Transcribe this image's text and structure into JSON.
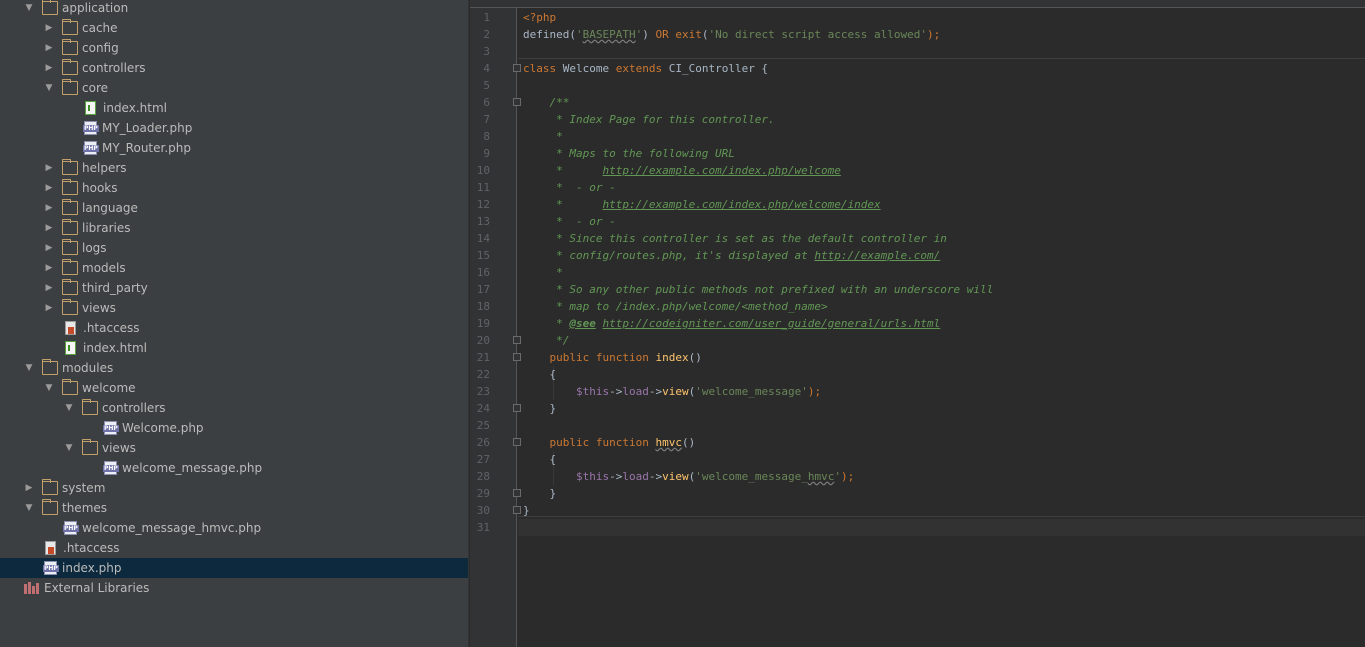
{
  "sidebar": {
    "rows": [
      {
        "id": "application",
        "depth": 0,
        "arrow": "open",
        "icon": "folder",
        "label": "application"
      },
      {
        "id": "cache",
        "depth": 1,
        "arrow": "closed",
        "icon": "folder",
        "label": "cache"
      },
      {
        "id": "config",
        "depth": 1,
        "arrow": "closed",
        "icon": "folder",
        "label": "config"
      },
      {
        "id": "controllers",
        "depth": 1,
        "arrow": "closed",
        "icon": "folder",
        "label": "controllers"
      },
      {
        "id": "core",
        "depth": 1,
        "arrow": "open",
        "icon": "folder",
        "label": "core"
      },
      {
        "id": "core-index-html",
        "depth": 2,
        "arrow": "none",
        "icon": "html",
        "label": "index.html"
      },
      {
        "id": "my-loader",
        "depth": 2,
        "arrow": "none",
        "icon": "php",
        "label": "MY_Loader.php"
      },
      {
        "id": "my-router",
        "depth": 2,
        "arrow": "none",
        "icon": "php",
        "label": "MY_Router.php"
      },
      {
        "id": "helpers",
        "depth": 1,
        "arrow": "closed",
        "icon": "folder",
        "label": "helpers"
      },
      {
        "id": "hooks",
        "depth": 1,
        "arrow": "closed",
        "icon": "folder",
        "label": "hooks"
      },
      {
        "id": "language",
        "depth": 1,
        "arrow": "closed",
        "icon": "folder",
        "label": "language"
      },
      {
        "id": "libraries",
        "depth": 1,
        "arrow": "closed",
        "icon": "folder",
        "label": "libraries"
      },
      {
        "id": "logs",
        "depth": 1,
        "arrow": "closed",
        "icon": "folder",
        "label": "logs"
      },
      {
        "id": "models",
        "depth": 1,
        "arrow": "closed",
        "icon": "folder",
        "label": "models"
      },
      {
        "id": "third-party",
        "depth": 1,
        "arrow": "closed",
        "icon": "folder",
        "label": "third_party"
      },
      {
        "id": "views",
        "depth": 1,
        "arrow": "closed",
        "icon": "folder",
        "label": "views"
      },
      {
        "id": "app-htaccess",
        "depth": 1,
        "arrow": "none",
        "icon": "htaccess",
        "label": ".htaccess"
      },
      {
        "id": "app-index-html",
        "depth": 1,
        "arrow": "none",
        "icon": "html",
        "label": "index.html"
      },
      {
        "id": "modules",
        "depth": 0,
        "arrow": "open",
        "icon": "folder",
        "label": "modules"
      },
      {
        "id": "welcome",
        "depth": 1,
        "arrow": "open",
        "icon": "folder",
        "label": "welcome"
      },
      {
        "id": "welcome-controllers",
        "depth": 2,
        "arrow": "open",
        "icon": "folder",
        "label": "controllers"
      },
      {
        "id": "welcome-php",
        "depth": 3,
        "arrow": "none",
        "icon": "php",
        "label": "Welcome.php"
      },
      {
        "id": "welcome-views",
        "depth": 2,
        "arrow": "open",
        "icon": "folder",
        "label": "views"
      },
      {
        "id": "welcome-message-php",
        "depth": 3,
        "arrow": "none",
        "icon": "php",
        "label": "welcome_message.php"
      },
      {
        "id": "system",
        "depth": 0,
        "arrow": "closed",
        "icon": "folder",
        "label": "system"
      },
      {
        "id": "themes",
        "depth": 0,
        "arrow": "open",
        "icon": "folder",
        "label": "themes"
      },
      {
        "id": "welcome-message-hmvc",
        "depth": 1,
        "arrow": "none",
        "icon": "php",
        "label": "welcome_message_hmvc.php"
      },
      {
        "id": "root-htaccess",
        "depth": 0,
        "arrow": "none",
        "icon": "htaccess",
        "label": ".htaccess"
      },
      {
        "id": "root-index-php",
        "depth": 0,
        "arrow": "none",
        "icon": "php",
        "label": "index.php",
        "selected": true
      },
      {
        "id": "external-libraries",
        "depth": -1,
        "arrow": "none",
        "icon": "library",
        "label": "External Libraries"
      }
    ]
  },
  "editor": {
    "line_numbers": [
      "1",
      "2",
      "3",
      "4",
      "5",
      "6",
      "7",
      "8",
      "9",
      "10",
      "11",
      "12",
      "13",
      "14",
      "15",
      "16",
      "17",
      "18",
      "19",
      "20",
      "21",
      "22",
      "23",
      "24",
      "25",
      "26",
      "27",
      "28",
      "29",
      "30",
      "31"
    ],
    "lines": [
      [
        {
          "t": "<?php",
          "c": "ptag"
        }
      ],
      [
        {
          "t": "defined(",
          "c": ""
        },
        {
          "t": "'",
          "c": "str"
        },
        {
          "t": "BASEPATH",
          "c": "str wavy"
        },
        {
          "t": "'",
          "c": "str"
        },
        {
          "t": ") ",
          "c": ""
        },
        {
          "t": "OR ",
          "c": "kw"
        },
        {
          "t": "exit",
          "c": "kw"
        },
        {
          "t": "(",
          "c": ""
        },
        {
          "t": "'No direct script access allowed'",
          "c": "str"
        },
        {
          "t": ");",
          "c": "kw"
        }
      ],
      [],
      [
        {
          "t": "class ",
          "c": "kw"
        },
        {
          "t": "Welcome ",
          "c": ""
        },
        {
          "t": "extends ",
          "c": "kw"
        },
        {
          "t": "CI_Controller {",
          "c": ""
        }
      ],
      [],
      [
        {
          "t": "    /**",
          "c": "cm"
        }
      ],
      [
        {
          "t": "     * Index Page for this controller.",
          "c": "cm"
        }
      ],
      [
        {
          "t": "     *",
          "c": "cm"
        }
      ],
      [
        {
          "t": "     * Maps to the following URL",
          "c": "cm"
        }
      ],
      [
        {
          "t": "     *      ",
          "c": "cm"
        },
        {
          "t": "http://example.com/index.php/welcome",
          "c": "url"
        }
      ],
      [
        {
          "t": "     *  - or -",
          "c": "cm"
        }
      ],
      [
        {
          "t": "     *      ",
          "c": "cm"
        },
        {
          "t": "http://example.com/index.php/welcome/index",
          "c": "url"
        }
      ],
      [
        {
          "t": "     *  - or -",
          "c": "cm"
        }
      ],
      [
        {
          "t": "     * Since this controller is set as the default controller in",
          "c": "cm"
        }
      ],
      [
        {
          "t": "     * config/routes.php, it's displayed at ",
          "c": "cm"
        },
        {
          "t": "http://example.com/",
          "c": "url"
        }
      ],
      [
        {
          "t": "     *",
          "c": "cm"
        }
      ],
      [
        {
          "t": "     * So any other public methods not prefixed with an underscore will",
          "c": "cm"
        }
      ],
      [
        {
          "t": "     * map to /index.php/welcome/<method_name>",
          "c": "cm"
        }
      ],
      [
        {
          "t": "     * ",
          "c": "cm"
        },
        {
          "t": "@see",
          "c": "tag"
        },
        {
          "t": " ",
          "c": "cm"
        },
        {
          "t": "http://codeigniter.com/user_guide/general/urls.html",
          "c": "url"
        }
      ],
      [
        {
          "t": "     */",
          "c": "cm"
        }
      ],
      [
        {
          "t": "    ",
          "c": ""
        },
        {
          "t": "public ",
          "c": "kw"
        },
        {
          "t": "function ",
          "c": "kw"
        },
        {
          "t": "index",
          "c": "fn"
        },
        {
          "t": "()",
          "c": ""
        }
      ],
      [
        {
          "t": "    {",
          "c": ""
        }
      ],
      [
        {
          "t": "        ",
          "c": ""
        },
        {
          "t": "$this",
          "c": "var"
        },
        {
          "t": "->",
          "c": ""
        },
        {
          "t": "load",
          "c": "var"
        },
        {
          "t": "->",
          "c": ""
        },
        {
          "t": "view",
          "c": "fn"
        },
        {
          "t": "(",
          "c": ""
        },
        {
          "t": "'welcome_message'",
          "c": "str"
        },
        {
          "t": ");",
          "c": "kw"
        }
      ],
      [
        {
          "t": "    }",
          "c": ""
        }
      ],
      [],
      [
        {
          "t": "    ",
          "c": ""
        },
        {
          "t": "public ",
          "c": "kw"
        },
        {
          "t": "function ",
          "c": "kw"
        },
        {
          "t": "hmvc",
          "c": "fn wavy"
        },
        {
          "t": "()",
          "c": ""
        }
      ],
      [
        {
          "t": "    {",
          "c": ""
        }
      ],
      [
        {
          "t": "        ",
          "c": ""
        },
        {
          "t": "$this",
          "c": "var"
        },
        {
          "t": "->",
          "c": ""
        },
        {
          "t": "load",
          "c": "var"
        },
        {
          "t": "->",
          "c": ""
        },
        {
          "t": "view",
          "c": "fn"
        },
        {
          "t": "(",
          "c": ""
        },
        {
          "t": "'welcome_message_",
          "c": "str"
        },
        {
          "t": "hmvc",
          "c": "str wavy"
        },
        {
          "t": "'",
          "c": "str"
        },
        {
          "t": ");",
          "c": "kw"
        }
      ],
      [
        {
          "t": "    }",
          "c": ""
        }
      ],
      [
        {
          "t": "}",
          "c": ""
        }
      ],
      []
    ],
    "fold_lines": [
      4,
      6,
      20,
      21,
      24,
      26,
      29,
      30
    ]
  },
  "colors": {
    "sidebar_bg": "#3c3f41",
    "editor_bg": "#2b2b2b",
    "selection": "#0d293e",
    "folder": "#c2a06b"
  }
}
